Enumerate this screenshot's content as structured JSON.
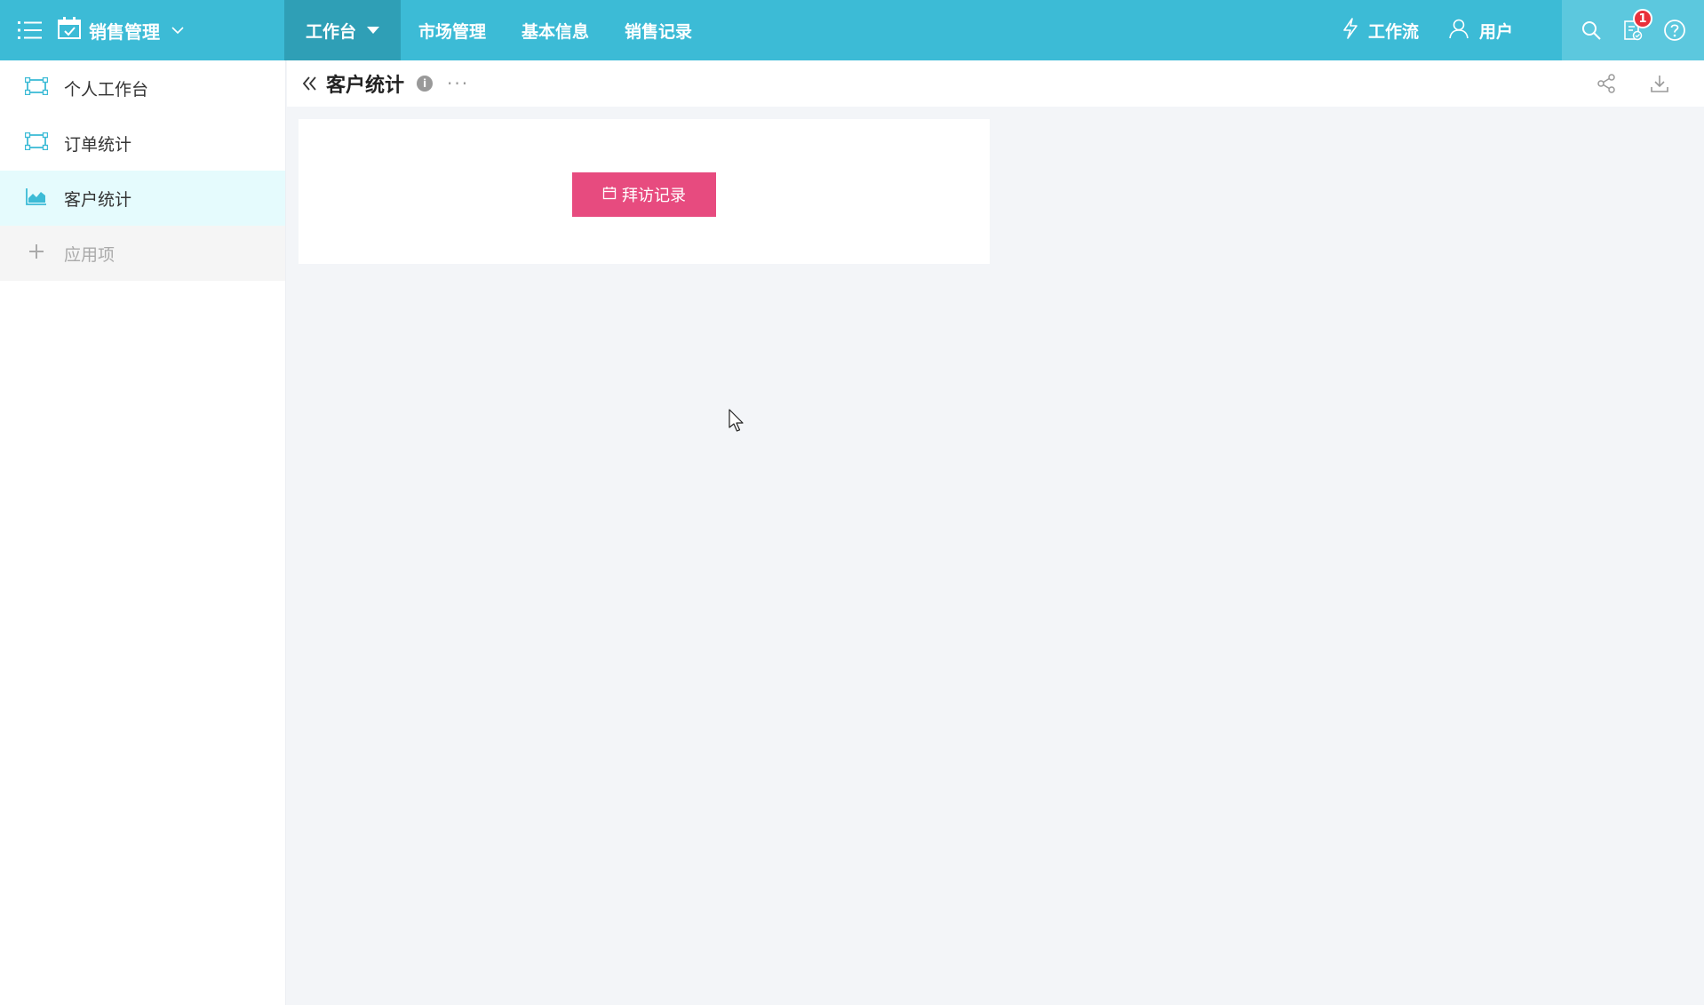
{
  "topbar": {
    "app_title": "销售管理",
    "nav": [
      "工作台",
      "市场管理",
      "基本信息",
      "销售记录"
    ],
    "tools": {
      "workflow": "工作流",
      "user": "用户"
    },
    "notification_count": "1",
    "colors": {
      "bar": "#3cbbd6",
      "active_tab": "#2f9fb6",
      "panel": "#5cc8de"
    }
  },
  "sidebar": {
    "items": [
      {
        "label": "个人工作台",
        "icon": "board-icon"
      },
      {
        "label": "订单统计",
        "icon": "board-icon"
      },
      {
        "label": "客户统计",
        "icon": "area-chart-icon"
      },
      {
        "label": "应用项",
        "icon": "plus-icon"
      }
    ]
  },
  "content": {
    "title": "客户统计",
    "info_label": "i",
    "more_label": "···",
    "visit_button_label": "拜访记录"
  }
}
